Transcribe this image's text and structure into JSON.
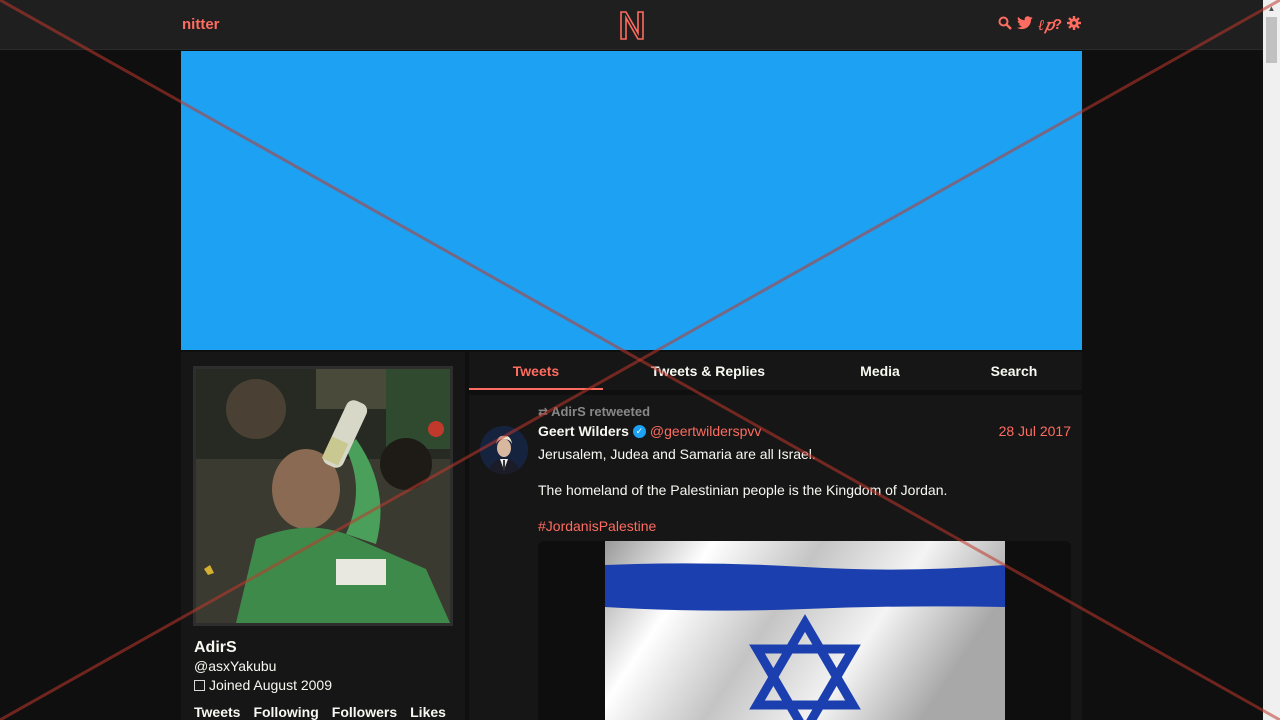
{
  "nav": {
    "brand": "nitter",
    "logo_letter": "N",
    "icons": [
      "search-icon",
      "twitter-icon",
      "rss-icon",
      "help-icon",
      "settings-icon"
    ]
  },
  "colors": {
    "accent": "#ff6c60",
    "banner": "#1da1f2",
    "background": "#0f0f0f",
    "panel": "#161616",
    "navbar": "#1f1f1f",
    "verified": "#1da1f2"
  },
  "profile": {
    "fullname": "AdirS",
    "username": "@asxYakubu",
    "joined": "Joined August 2009",
    "stats": [
      "Tweets",
      "Following",
      "Followers",
      "Likes"
    ]
  },
  "tabs": [
    {
      "label": "Tweets",
      "active": true
    },
    {
      "label": "Tweets & Replies",
      "active": false
    },
    {
      "label": "Media",
      "active": false
    },
    {
      "label": "Search",
      "active": false
    }
  ],
  "tweet": {
    "retweet_label": "AdirS retweeted",
    "author_name": "Geert Wilders",
    "author_handle": "@geertwilderspvv",
    "date": "28 Jul 2017",
    "paragraph1": "Jerusalem, Judea and Samaria are all Israel.",
    "paragraph2": "The homeland of the Palestinian people is the Kingdom of Jordan.",
    "hashtag": "#JordanisPalestine"
  }
}
